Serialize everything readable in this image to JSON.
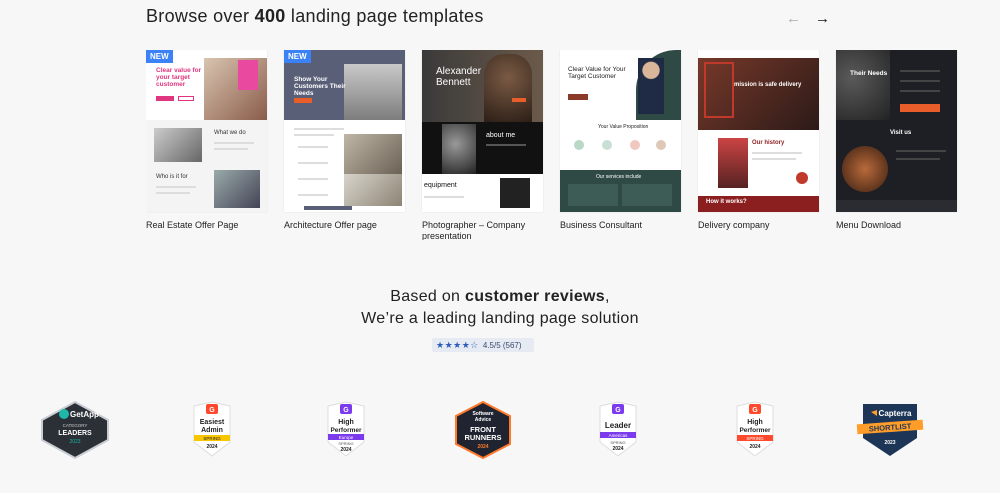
{
  "section": {
    "heading_prefix": "Browse over",
    "heading_count": "400",
    "heading_suffix": "landing page templates",
    "prev_icon": "←",
    "next_icon": "→"
  },
  "templates": [
    {
      "title": "Real Estate Offer Page",
      "badge": "NEW",
      "hero": "Clear value for your target customer",
      "sub1": "What we do",
      "sub2": "Who is it for"
    },
    {
      "title": "Architecture Offer page",
      "badge": "NEW",
      "hero": "Show Your Customers Their Needs"
    },
    {
      "title": "Photographer – Company presentation",
      "hero": "Alexander Bennett",
      "sub1": "about me",
      "sub2": "equipment"
    },
    {
      "title": "Business Consultant",
      "hero": "Clear Value for Your Target Customer",
      "sub1": "Your Value Proposition",
      "sub2": "Our services include"
    },
    {
      "title": "Delivery company",
      "hero": "mission is safe delivery",
      "sub1": "Our history",
      "sub2": "How it works?"
    },
    {
      "title": "Menu Download",
      "hero": "Their Needs",
      "sub1": "Visit us"
    }
  ],
  "reviews": {
    "line1_prefix": "Based on",
    "line1_bold": "customer reviews",
    "line1_suffix": ",",
    "line2": "We’re a leading landing page solution",
    "stars": "★★★★☆",
    "score": "4.5/5 (567)"
  },
  "awards": [
    {
      "name": "GetApp",
      "l1": "GetApp",
      "l2": "CATEGORY",
      "l3": "LEADERS",
      "l4": "2023"
    },
    {
      "name": "G2 Easiest Admin",
      "l1": "Easiest",
      "l2": "Admin",
      "l3": "SPRING",
      "l4": "2024"
    },
    {
      "name": "G2 High Performer Europe",
      "l1": "High",
      "l2": "Performer",
      "l3": "Europe",
      "l4": "SPRING",
      "l5": "2024"
    },
    {
      "name": "Software Advice Front Runners",
      "l1": "Software",
      "l2": "Advice",
      "l3": "FRONT",
      "l4": "RUNNERS",
      "l5": "2024"
    },
    {
      "name": "G2 Leader Americas",
      "l1": "Leader",
      "l2": "Americas",
      "l3": "SPRING",
      "l4": "2024"
    },
    {
      "name": "G2 High Performer",
      "l1": "High",
      "l2": "Performer",
      "l3": "SPRING",
      "l4": "2024"
    },
    {
      "name": "Capterra Shortlist",
      "l1": "Capterra",
      "l2": "SHORTLIST",
      "l3": "2023"
    }
  ],
  "colors": {
    "accent_blue": "#3b82f6",
    "g2_red": "#ff492c",
    "g2_purple": "#7c3aed",
    "capterra_navy": "#1d3557",
    "delivery_red": "#8b1e1e"
  }
}
